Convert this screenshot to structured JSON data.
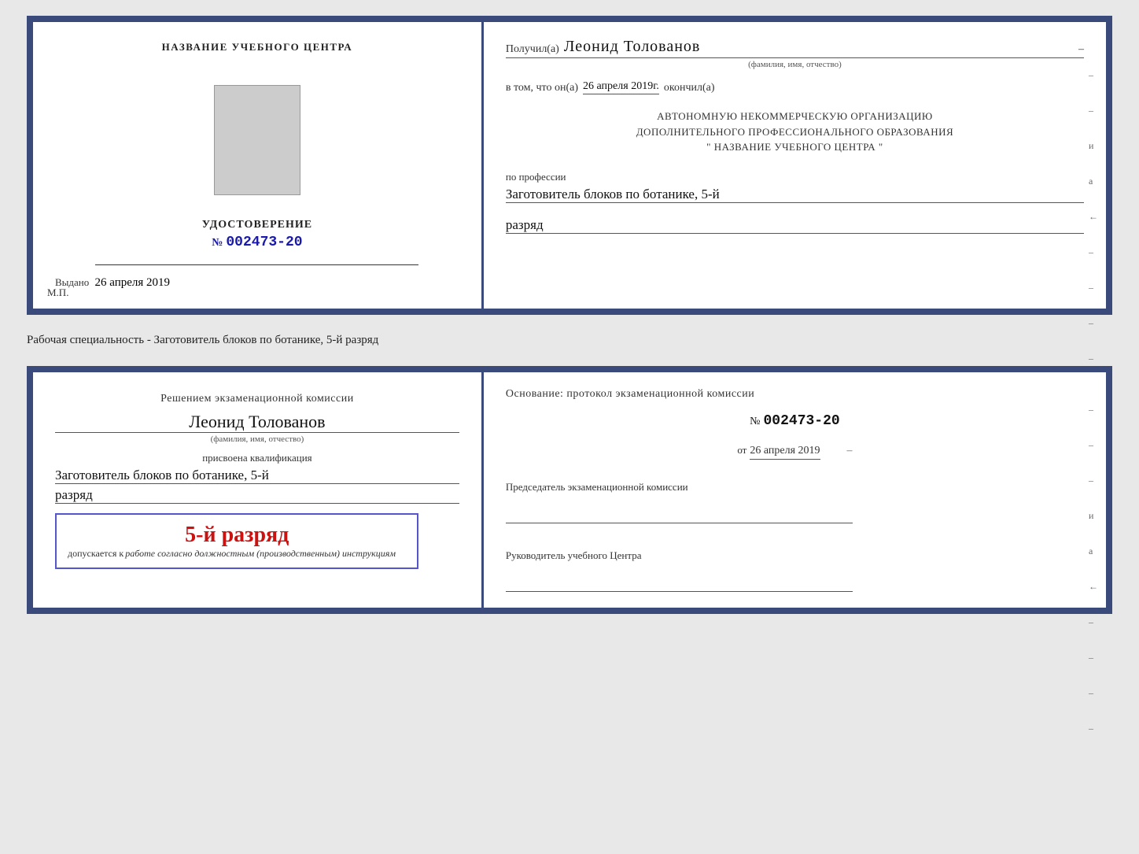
{
  "cert1": {
    "left": {
      "title": "НАЗВАНИЕ УЧЕБНОГО ЦЕНТРА",
      "photo_alt": "photo",
      "udostoverenie": "УДОСТОВЕРЕНИЕ",
      "number_prefix": "№",
      "number": "002473-20",
      "vydano_label": "Выдано",
      "vydano_date": "26 апреля 2019",
      "mp_label": "М.П."
    },
    "right": {
      "poluchil_label": "Получил(а)",
      "name": "Леонид Толованов",
      "fio_label": "(фамилия, имя, отчество)",
      "vtom_label": "в том, что он(а)",
      "vtom_date": "26 апреля 2019г.",
      "okonchill_label": "окончил(а)",
      "autonomous_line1": "АВТОНОМНУЮ НЕКОММЕРЧЕСКУЮ ОРГАНИЗАЦИЮ",
      "autonomous_line2": "ДОПОЛНИТЕЛЬНОГО ПРОФЕССИОНАЛЬНОГО ОБРАЗОВАНИЯ",
      "autonomous_line3": "\"  НАЗВАНИЕ УЧЕБНОГО ЦЕНТРА  \"",
      "profession_label": "по профессии",
      "profession": "Заготовитель блоков по ботанике, 5-й",
      "razryad": "разряд",
      "dashes": [
        "-",
        "-",
        "и",
        "а",
        "←",
        "-",
        "-",
        "-",
        "-",
        "-"
      ]
    }
  },
  "specialty_label": "Рабочая специальность - Заготовитель блоков по ботанике, 5-й разряд",
  "cert2": {
    "left": {
      "resheniem_title": "Решением экзаменационной комиссии",
      "name": "Леонид Толованов",
      "fio_label": "(фамилия, имя, отчество)",
      "prisvoena_label": "присвоена квалификация",
      "profession": "Заготовитель блоков по ботанике, 5-й",
      "razryad": "разряд",
      "stamp_razryad": "5-й разряд",
      "dopusk_label": "допускается к",
      "dopusk_italic": "работе согласно должностным (производственным) инструкциям"
    },
    "right": {
      "osnovanie_title": "Основание: протокол экзаменационной комиссии",
      "number_prefix": "№",
      "number": "002473-20",
      "ot_label": "от",
      "ot_date": "26 апреля 2019",
      "predsedatel_label": "Председатель экзаменационной комиссии",
      "rukovoditel_label": "Руководитель учебного Центра",
      "dashes": [
        "-",
        "-",
        "-",
        "и",
        "а",
        "←",
        "-",
        "-",
        "-",
        "-"
      ]
    }
  }
}
